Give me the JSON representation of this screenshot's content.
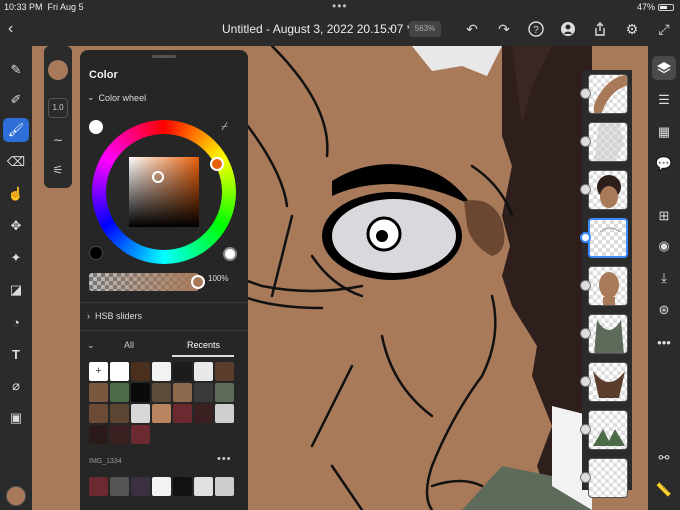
{
  "status": {
    "time": "10:33 PM",
    "date": "Fri Aug 5",
    "battery": "47%",
    "battery_level": 0.47
  },
  "topbar": {
    "title": "Untitled - August 3, 2022 20.15.07 *",
    "zoom": "563%",
    "icons": [
      "back-chevron-icon",
      "title-chevron-icon",
      "undo-icon",
      "redo-icon",
      "help-icon",
      "cloud-account-icon",
      "share-icon",
      "settings-gear-icon",
      "fullscreen-icon"
    ]
  },
  "left_toolbar": {
    "tools": [
      "brush-plus-icon",
      "wand-brush-icon",
      "paint-brush-icon",
      "eraser-icon",
      "smudge-icon",
      "move-transform-icon",
      "magic-selection-icon",
      "fill-bucket-icon",
      "shape-icon",
      "type-icon",
      "eyedropper-icon",
      "image-icon"
    ],
    "active_tool": "paint-brush-icon",
    "current_color": "#a87a5a"
  },
  "brush": {
    "color": "#a87a5a",
    "size": "1.0"
  },
  "color_panel": {
    "title": "Color",
    "wheel_section": "Color wheel",
    "hue_color": "#e8600a",
    "opacity": "100%",
    "hsb_section": "HSB sliders",
    "tabs": {
      "all": "All",
      "recents": "Recents"
    },
    "add_symbol": "+",
    "recent_swatches": [
      "#ffffff",
      "#4a2f1c",
      "#f2f2f2",
      "#1c1c1c",
      "#e8e8e8",
      "#5a3d2b",
      "#7a5840",
      "#4d6b48",
      "#0a0a0a",
      "#5c4a3a",
      "#8c6a4e",
      "#3a3a3a",
      "#5e6b5a",
      "#6b4a36",
      "#5c4433",
      "#d8d8d8",
      "#b88560",
      "#6a2a30",
      "#3a2020",
      "#cfcfcf",
      "#2a1a1a",
      "#3a2020",
      "#6a2a30"
    ],
    "image_label": "IMG_1334",
    "image_swatches": [
      "#6a2a30",
      "#555555",
      "#3a3040",
      "#f2f2f2",
      "#111111",
      "#e0e0e0",
      "#cccccc"
    ]
  },
  "layers": [
    {
      "name": "layer-1"
    },
    {
      "name": "layer-2"
    },
    {
      "name": "layer-3"
    },
    {
      "name": "layer-4",
      "selected": true
    },
    {
      "name": "layer-5"
    },
    {
      "name": "layer-6"
    },
    {
      "name": "layer-7"
    },
    {
      "name": "layer-8"
    },
    {
      "name": "layer-9"
    }
  ],
  "right_toolbar": {
    "tools": [
      "layers-icon",
      "adjustments-icon",
      "grid-icon",
      "comment-icon",
      "add-layer-icon",
      "visibility-eye-icon",
      "merge-down-icon",
      "blend-mode-icon",
      "more-icon",
      "mask-icon",
      "ruler-icon"
    ]
  }
}
